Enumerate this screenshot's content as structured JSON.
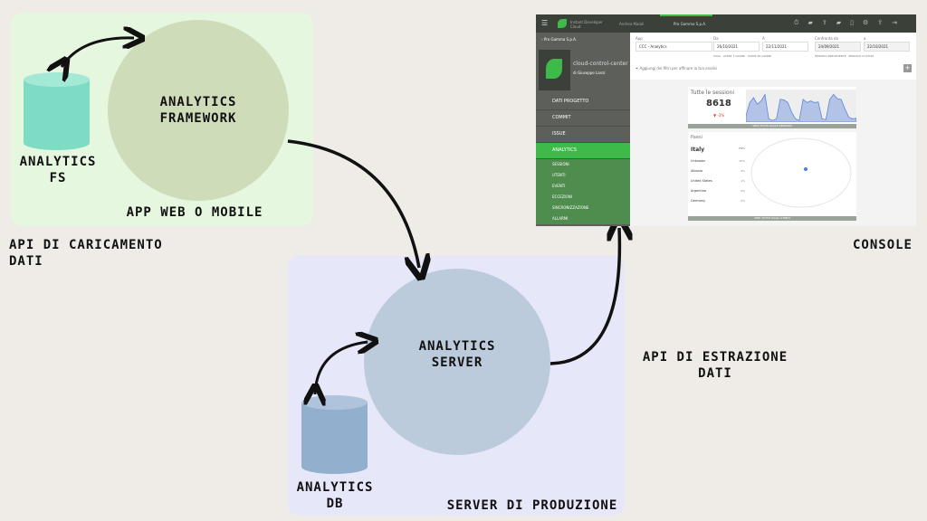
{
  "colors": {
    "background": "#efebe7",
    "client_panel": "#e6f7e0",
    "server_panel": "#e6e8fa",
    "framework_circle": "#cfdcb9",
    "server_circle": "#bccbdc",
    "fs_cylinder": "#7fdcc4",
    "db_cylinder": "#93afce",
    "accent_green": "#3dba4a"
  },
  "client": {
    "panel_label": "App web o mobile",
    "framework": "Analytics Framework",
    "fs": "Analytics FS",
    "api_label": "API di caricamento dati"
  },
  "server": {
    "panel_label": "Server di produzione",
    "server": "Analytics Server",
    "db": "Analytics DB",
    "api_label": "API di estrazione dati"
  },
  "console": {
    "label": "Console",
    "topbar": {
      "brand": "Instant Developer Cloud",
      "user": "Andrea Maioli",
      "tab": "Pro Gamma S.p.A.",
      "icons": [
        "timer-icon",
        "chat-icon",
        "upload-icon",
        "comments-icon",
        "phone-icon",
        "gear-icon",
        "user-icon",
        "logout-icon"
      ]
    },
    "sidebar": {
      "back": "Pro Gamma S.p.A.",
      "project": "cloud-control-center",
      "owner_prefix": "di",
      "owner": "Giuseppe Lanzi",
      "items": [
        {
          "label": "DATI PROGETTO"
        },
        {
          "label": "COMMIT"
        },
        {
          "label": "ISSUE"
        },
        {
          "label": "ANALYTICS"
        }
      ],
      "subitems": [
        {
          "label": "SESSIONI"
        },
        {
          "label": "UTENTI"
        },
        {
          "label": "EVENTI"
        },
        {
          "label": "ECCEZIONI"
        },
        {
          "label": "SINCRONIZZAZIONE"
        },
        {
          "label": "ALLARMI"
        }
      ]
    },
    "filters": {
      "app_label": "App",
      "app_value": "CCC - Analytics",
      "da_label": "Da",
      "da_value": "26/10/2021",
      "a_label": "A",
      "a_value": "22/11/2021",
      "confronta_label": "Confronta da",
      "confronta_value": "24/09/2021",
      "a2_label": "a",
      "a2_value": "22/10/2021",
      "quick": [
        "OGGI",
        "ULTIMI 7 GIORNI",
        "ULTIMI 30 GIORNI"
      ],
      "compare_quick": [
        "PERIODO PRECEDENTE",
        "PERIODO CUSTOM"
      ],
      "filter_placeholder": "Aggiungi dei filtri per affinare la tua analisi"
    },
    "sessions": {
      "title": "Tutte le sessioni",
      "value": "8618",
      "delta": "-3%",
      "footer": "VEDI TUTTO SULLE SESSIONI",
      "trend": [
        20,
        60,
        75,
        55,
        65,
        85,
        10,
        5,
        10,
        70,
        68,
        60,
        30,
        10,
        5,
        70,
        60,
        65,
        60,
        62,
        10,
        8,
        70,
        85,
        72,
        70,
        40,
        15,
        10,
        12
      ]
    },
    "countries": {
      "title": "Paesi",
      "footer": "VEDI TUTTO SUGLI UTENTI",
      "rows": [
        {
          "name": "Italy",
          "pct": "74%"
        },
        {
          "name": "Unknown",
          "pct": "20%"
        },
        {
          "name": "Albania",
          "pct": "3%"
        },
        {
          "name": "United States",
          "pct": "1%"
        },
        {
          "name": "Argentina",
          "pct": "0%"
        },
        {
          "name": "Germany",
          "pct": "0%"
        }
      ]
    }
  }
}
